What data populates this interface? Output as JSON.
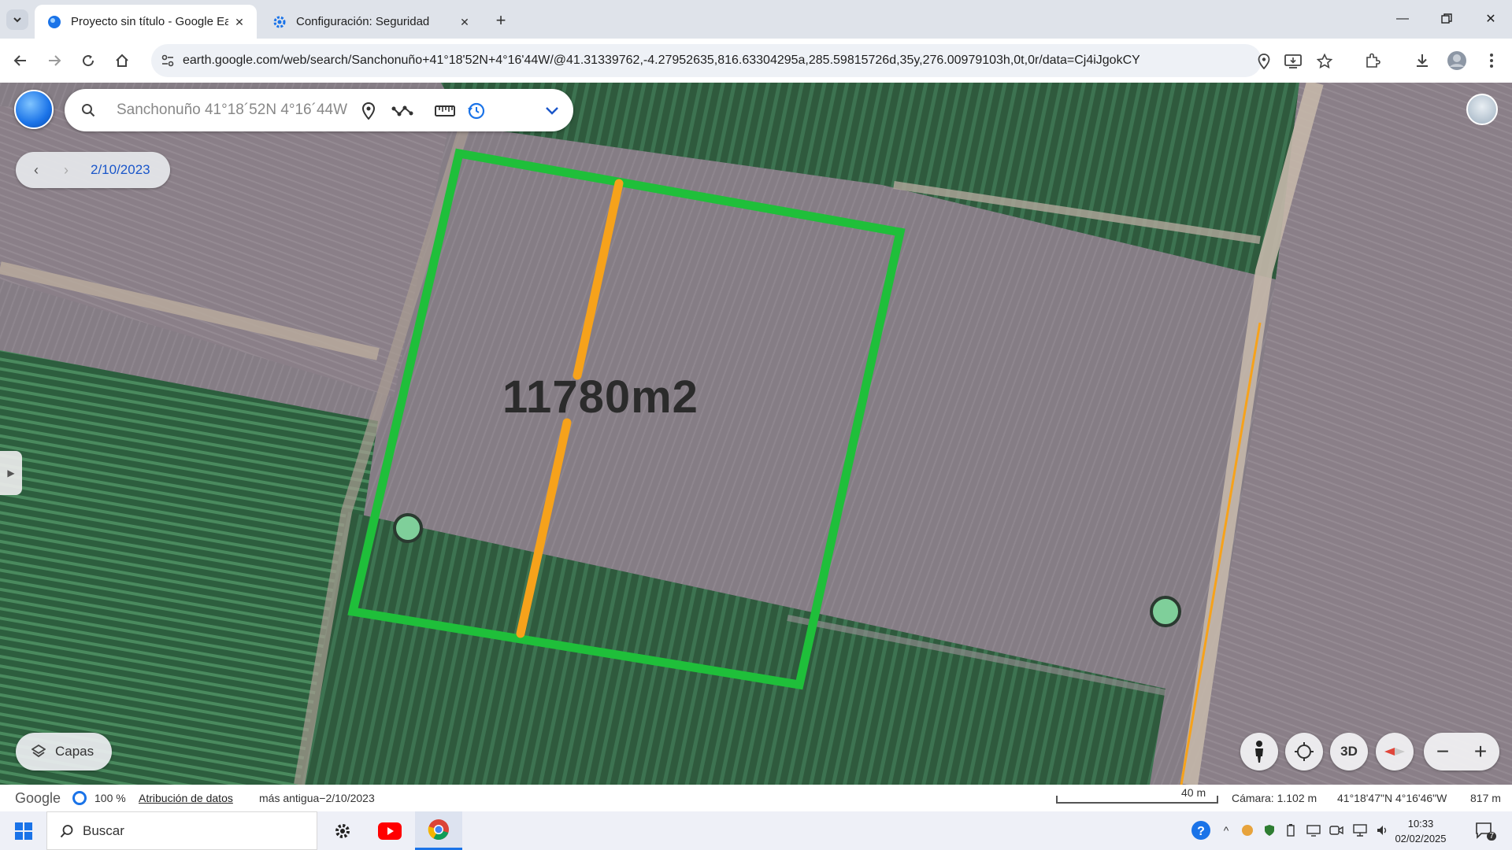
{
  "browser": {
    "tabs": [
      {
        "title": "Proyecto sin título - Google Earth",
        "active": true
      },
      {
        "title": "Configuración: Seguridad",
        "active": false
      }
    ],
    "url": "earth.google.com/web/search/Sanchonuño+41°18'52N+4°16'44W/@41.31339762,-4.27952635,816.63304295a,285.59815726d,35y,276.00979103h,0t,0r/data=Cj4iJgokCYm5e7wgq0..."
  },
  "earth": {
    "search_value": "Sanchonuño 41°18´52N 4°16´44W",
    "date": "2/10/2023",
    "layers_label": "Capas",
    "area_label": "11780m2",
    "btn_3d": "3D",
    "zoom_out": "−",
    "zoom_in": "+"
  },
  "status": {
    "google": "Google",
    "percent": "100 %",
    "attribution": "Atribución de datos",
    "oldest": "más antigua−2/10/2023",
    "scale": "40 m",
    "camera": "Cámara: 1.102 m",
    "coords": "41°18'47\"N 4°16'46\"W",
    "elevation": "817 m"
  },
  "taskbar": {
    "search_label": "Buscar",
    "time": "10:33",
    "date": "02/02/2025",
    "notifications": "7"
  },
  "colors": {
    "polygon": "#1fbf3a",
    "measure_line": "#f6a21b",
    "accent": "#1a73e8"
  }
}
